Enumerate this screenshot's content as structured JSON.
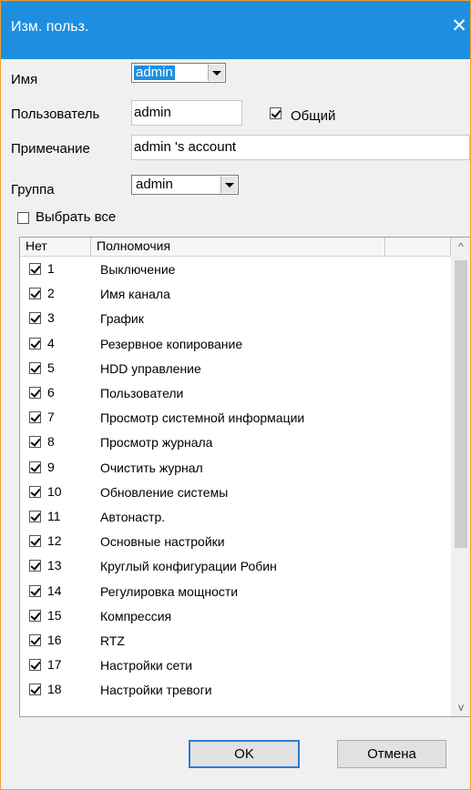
{
  "window": {
    "title": "Изм. польз.",
    "close_glyph": "✕"
  },
  "form": {
    "name_label": "Имя",
    "name_value": "admin",
    "user_label": "Пользователь",
    "user_value": "admin",
    "shared_label": "Общий",
    "shared_checked": true,
    "note_label": "Примечание",
    "note_value": "admin 's account",
    "group_label": "Группа",
    "group_value": "admin",
    "select_all_label": "Выбрать все",
    "select_all_checked": false
  },
  "table": {
    "col_no": "Нет",
    "col_permission": "Полномочия",
    "rows": [
      {
        "num": "1",
        "name": "Выключение",
        "checked": true
      },
      {
        "num": "2",
        "name": "Имя канала",
        "checked": true
      },
      {
        "num": "3",
        "name": "График",
        "checked": true
      },
      {
        "num": "4",
        "name": "Резервное копирование",
        "checked": true
      },
      {
        "num": "5",
        "name": "HDD управление",
        "checked": true
      },
      {
        "num": "6",
        "name": "Пользователи",
        "checked": true
      },
      {
        "num": "7",
        "name": "Просмотр системной информации",
        "checked": true
      },
      {
        "num": "8",
        "name": "Просмотр журнала",
        "checked": true
      },
      {
        "num": "9",
        "name": "Очистить журнал",
        "checked": true
      },
      {
        "num": "10",
        "name": "Обновление системы",
        "checked": true
      },
      {
        "num": "11",
        "name": "Автонастр.",
        "checked": true
      },
      {
        "num": "12",
        "name": "Основные настройки",
        "checked": true
      },
      {
        "num": "13",
        "name": "Круглый конфигурации Робин",
        "checked": true
      },
      {
        "num": "14",
        "name": "Регулировка мощности",
        "checked": true
      },
      {
        "num": "15",
        "name": "Компрессия",
        "checked": true
      },
      {
        "num": "16",
        "name": "RTZ",
        "checked": true
      },
      {
        "num": "17",
        "name": "Настройки сети",
        "checked": true
      },
      {
        "num": "18",
        "name": "Настройки тревоги",
        "checked": true
      }
    ]
  },
  "buttons": {
    "ok": "OK",
    "cancel": "Отмена"
  },
  "icons": {
    "scroll_up": "^",
    "scroll_down": "v"
  },
  "colors": {
    "titlebar": "#1e8fe0",
    "selection": "#1e8fe0",
    "window_border": "#f0a030"
  }
}
